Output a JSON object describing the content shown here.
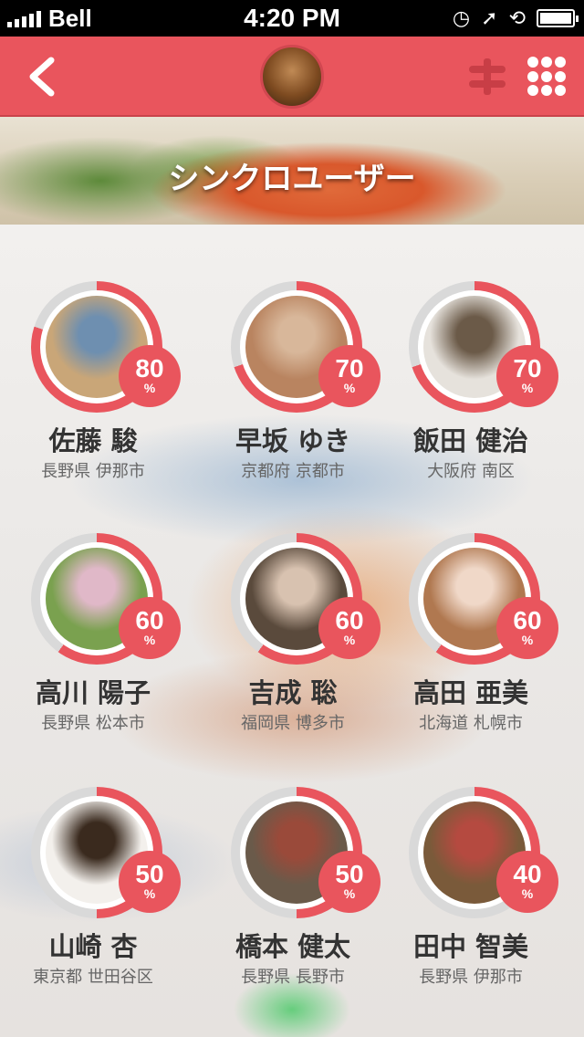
{
  "status_bar": {
    "carrier": "Bell",
    "time": "4:20 PM"
  },
  "nav": {
    "back_icon": "chevron-left-icon",
    "filter_icon": "filter-sliders-icon",
    "grid_icon": "grid-menu-icon"
  },
  "hero": {
    "title": "シンクロユーザー"
  },
  "colors": {
    "accent": "#e9555d",
    "ring_track": "#d9d9d9"
  },
  "users": [
    {
      "name": "佐藤 駿",
      "location": "長野県 伊那市",
      "percent": "80",
      "percent_value": 80,
      "sign": "%"
    },
    {
      "name": "早坂 ゆき",
      "location": "京都府 京都市",
      "percent": "70",
      "percent_value": 70,
      "sign": "%"
    },
    {
      "name": "飯田 健治",
      "location": "大阪府 南区",
      "percent": "70",
      "percent_value": 70,
      "sign": "%"
    },
    {
      "name": "高川 陽子",
      "location": "長野県 松本市",
      "percent": "60",
      "percent_value": 60,
      "sign": "%"
    },
    {
      "name": "吉成 聡",
      "location": "福岡県 博多市",
      "percent": "60",
      "percent_value": 60,
      "sign": "%"
    },
    {
      "name": "高田 亜美",
      "location": "北海道 札幌市",
      "percent": "60",
      "percent_value": 60,
      "sign": "%"
    },
    {
      "name": "山崎 杏",
      "location": "東京都 世田谷区",
      "percent": "50",
      "percent_value": 50,
      "sign": "%"
    },
    {
      "name": "橋本 健太",
      "location": "長野県 長野市",
      "percent": "50",
      "percent_value": 50,
      "sign": "%"
    },
    {
      "name": "田中 智美",
      "location": "長野県 伊那市",
      "percent": "40",
      "percent_value": 40,
      "sign": "%"
    }
  ]
}
